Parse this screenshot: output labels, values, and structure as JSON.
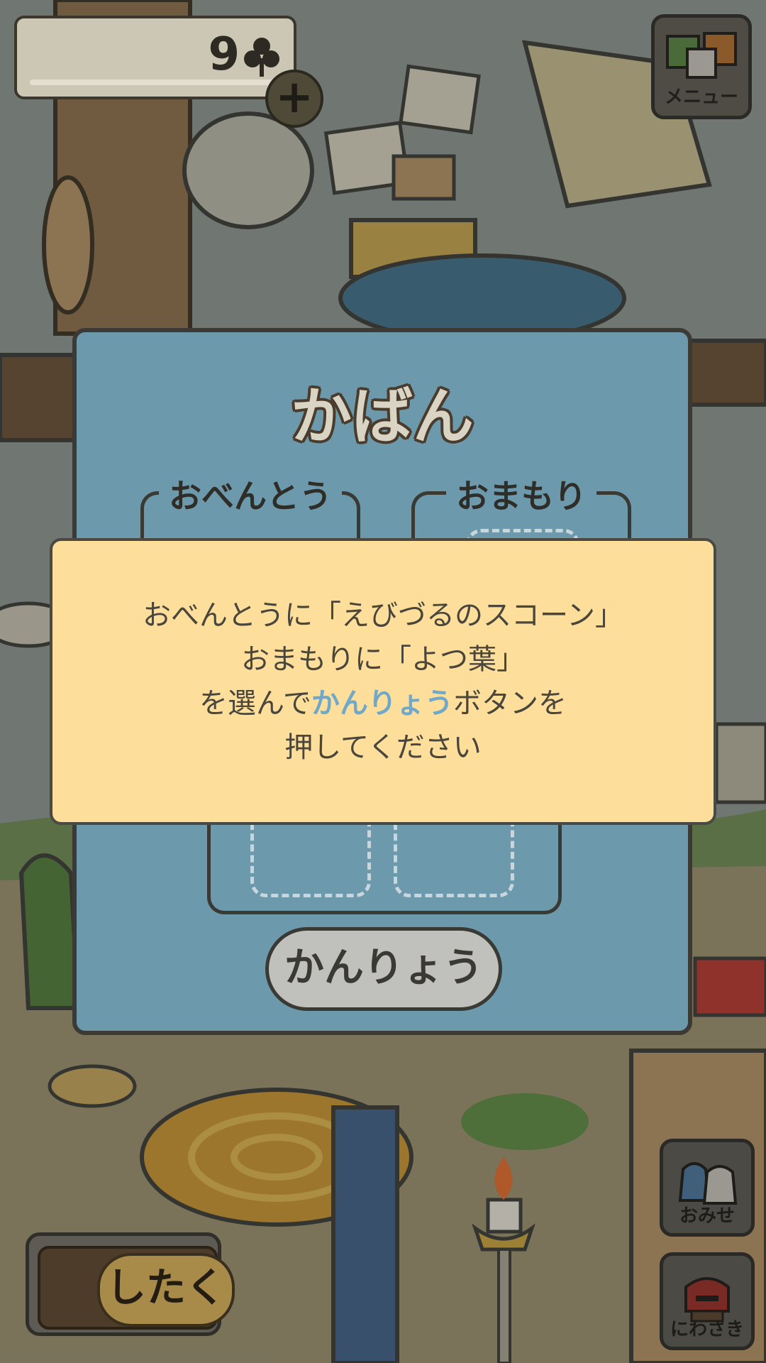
{
  "hud": {
    "clover_count": "9",
    "add_button": "+",
    "menu_label": "メニュー"
  },
  "bag": {
    "title": "かばん",
    "lunch_label": "おべんとう",
    "charm_label": "おまもり",
    "done_label": "かんりょう"
  },
  "instruction": {
    "line1": "おべんとうに「えびづるのスコーン」",
    "line2": "おまもりに「よつ葉」",
    "line3_pre": "を選んで",
    "line3_highlight": "かんりょう",
    "line3_post": "ボタンを",
    "line4": "押してください"
  },
  "side": {
    "shop_label": "おみせ",
    "garden_label": "にわさき",
    "prepare_label": "したく"
  },
  "colors": {
    "panel": "#6d99ad",
    "popup": "#fddf9b",
    "highlight": "#6fa8c8"
  }
}
